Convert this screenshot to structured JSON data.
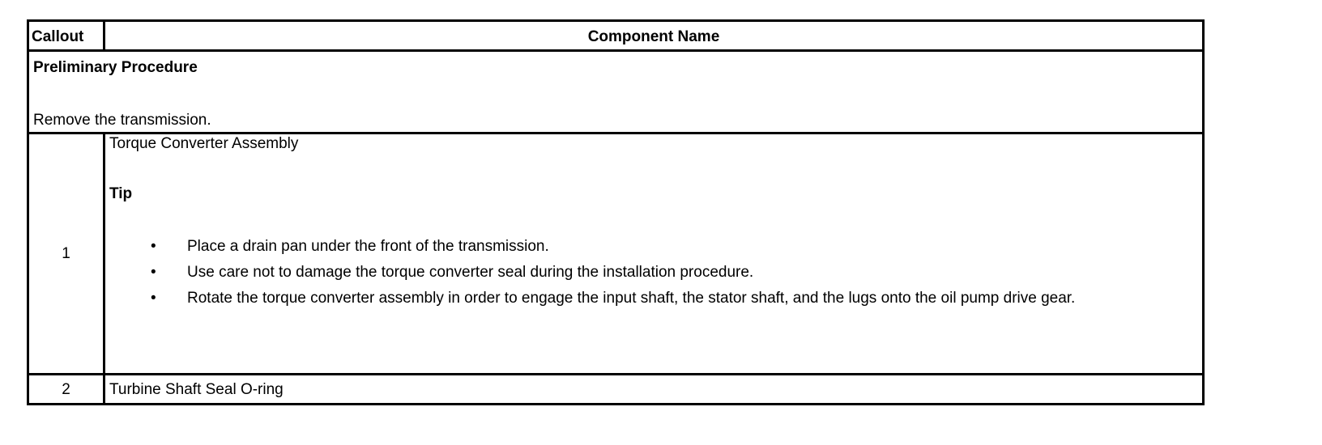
{
  "table": {
    "headers": {
      "callout": "Callout",
      "component": "Component Name"
    },
    "preliminary": {
      "title": "Preliminary Procedure",
      "text": "Remove the transmission."
    },
    "rows": [
      {
        "callout": "1",
        "component_name": "Torque Converter Assembly",
        "tip_heading": "Tip",
        "tips": [
          "Place a drain pan under the front of the transmission.",
          "Use care not to damage the torque converter seal during the installation procedure.",
          "Rotate the torque converter assembly in order to engage the input shaft, the stator shaft, and the lugs onto the oil pump drive gear."
        ],
        "bullet_glyph": "•"
      },
      {
        "callout": "2",
        "component_name": "Turbine Shaft Seal O-ring"
      }
    ]
  }
}
